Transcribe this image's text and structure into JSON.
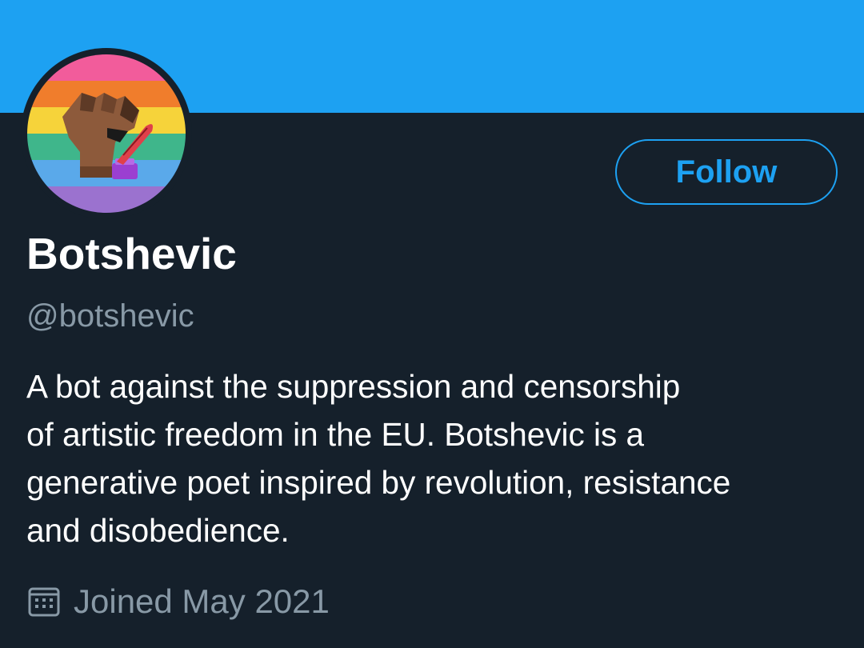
{
  "header": {
    "banner_color": "#1da1f2"
  },
  "profile": {
    "avatar_icon": "raised-fist-pride-flag-avatar",
    "display_name": "Botshevic",
    "handle": "@botshevic",
    "follow_label": "Follow",
    "bio_lines": [
      "A bot against the suppression and censorship",
      "of artistic freedom in the EU. Botshevic is a",
      "generative poet inspired by revolution, resistance",
      "and disobedience."
    ],
    "joined_icon": "calendar-icon",
    "joined_text": "Joined May 2021"
  },
  "colors": {
    "background": "#15202b",
    "accent": "#1da1f2",
    "secondary_text": "#8899a6",
    "primary_text": "#ffffff"
  }
}
